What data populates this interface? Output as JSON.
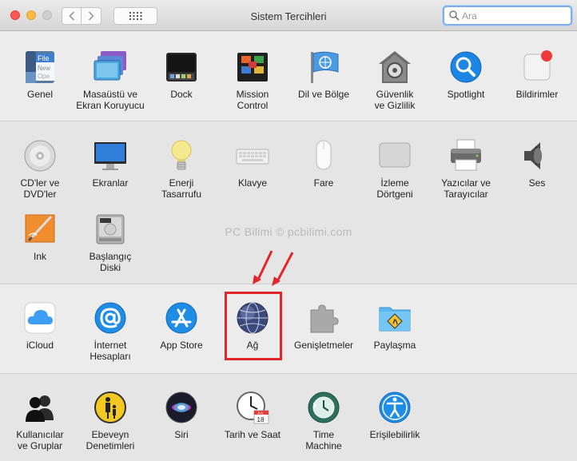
{
  "window": {
    "title": "Sistem Tercihleri",
    "search_placeholder": "Ara"
  },
  "watermark": "PC Bilimi © pcbilimi.com",
  "sections": [
    {
      "items": [
        {
          "label": "Genel",
          "icon": "general-icon"
        },
        {
          "label": "Masaüstü ve\nEkran Koruyucu",
          "icon": "desktop-screensaver-icon"
        },
        {
          "label": "Dock",
          "icon": "dock-icon"
        },
        {
          "label": "Mission\nControl",
          "icon": "mission-control-icon"
        },
        {
          "label": "Dil ve Bölge",
          "icon": "language-region-icon"
        },
        {
          "label": "Güvenlik\nve Gizlilik",
          "icon": "security-privacy-icon"
        },
        {
          "label": "Spotlight",
          "icon": "spotlight-icon"
        },
        {
          "label": "Bildirimler",
          "icon": "notifications-icon"
        }
      ]
    },
    {
      "items": [
        {
          "label": "CD'ler ve\nDVD'ler",
          "icon": "cd-dvd-icon"
        },
        {
          "label": "Ekranlar",
          "icon": "displays-icon"
        },
        {
          "label": "Enerji\nTasarrufu",
          "icon": "energy-saver-icon"
        },
        {
          "label": "Klavye",
          "icon": "keyboard-icon"
        },
        {
          "label": "Fare",
          "icon": "mouse-icon"
        },
        {
          "label": "İzleme\nDörtgeni",
          "icon": "trackpad-icon"
        },
        {
          "label": "Yazıcılar ve\nTarayıcılar",
          "icon": "printers-scanners-icon"
        },
        {
          "label": "Ses",
          "icon": "sound-icon"
        },
        {
          "label": "Ink",
          "icon": "ink-icon"
        },
        {
          "label": "Başlangıç\nDiski",
          "icon": "startup-disk-icon"
        }
      ]
    },
    {
      "items": [
        {
          "label": "iCloud",
          "icon": "icloud-icon"
        },
        {
          "label": "İnternet\nHesapları",
          "icon": "internet-accounts-icon"
        },
        {
          "label": "App Store",
          "icon": "app-store-icon"
        },
        {
          "label": "Ağ",
          "icon": "network-icon"
        },
        {
          "label": "Genişletmeler",
          "icon": "extensions-icon"
        },
        {
          "label": "Paylaşma",
          "icon": "sharing-icon"
        }
      ]
    },
    {
      "items": [
        {
          "label": "Kullanıcılar\nve Gruplar",
          "icon": "users-groups-icon"
        },
        {
          "label": "Ebeveyn\nDenetimleri",
          "icon": "parental-controls-icon"
        },
        {
          "label": "Siri",
          "icon": "siri-icon"
        },
        {
          "label": "Tarih ve Saat",
          "icon": "date-time-icon"
        },
        {
          "label": "Time\nMachine",
          "icon": "time-machine-icon"
        },
        {
          "label": "Erişilebilirlik",
          "icon": "accessibility-icon"
        }
      ]
    }
  ],
  "icon_texts": {
    "general_file": "File",
    "general_new": "New",
    "general_open": "Ope",
    "calendar_month": "JUL",
    "calendar_day": "18"
  },
  "colors": {
    "highlight": "#e2262b",
    "search_focus": "#7eaee7"
  }
}
